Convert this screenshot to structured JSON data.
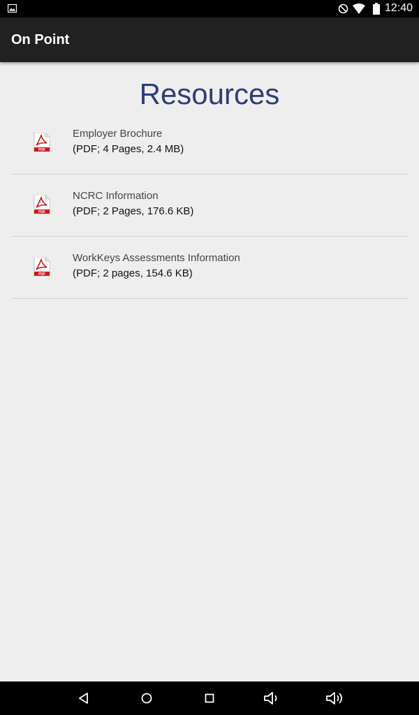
{
  "status_bar": {
    "time": "12:40",
    "icons": [
      "image-notification-icon",
      "do-not-disturb-icon",
      "wifi-icon",
      "battery-icon"
    ]
  },
  "app_bar": {
    "title": "On Point"
  },
  "page": {
    "title": "Resources"
  },
  "resources": [
    {
      "name": "Employer Brochure",
      "details": "(PDF; 4 Pages, 2.4 MB)",
      "icon": "pdf-icon"
    },
    {
      "name": "NCRC Information",
      "details": "(PDF; 2 Pages, 176.6 KB)",
      "icon": "pdf-icon"
    },
    {
      "name": "WorkKeys Assessments Information",
      "details": "(PDF; 2 pages, 154.6 KB)",
      "icon": "pdf-icon"
    }
  ],
  "nav_bar": {
    "buttons": [
      "back-icon",
      "home-icon",
      "recents-icon",
      "volume-down-icon",
      "volume-up-icon"
    ]
  },
  "colors": {
    "status_bar": "#000000",
    "app_bar": "#212121",
    "background": "#eeeeee",
    "title": "#2e3e74",
    "pdf_red": "#d0161d"
  }
}
